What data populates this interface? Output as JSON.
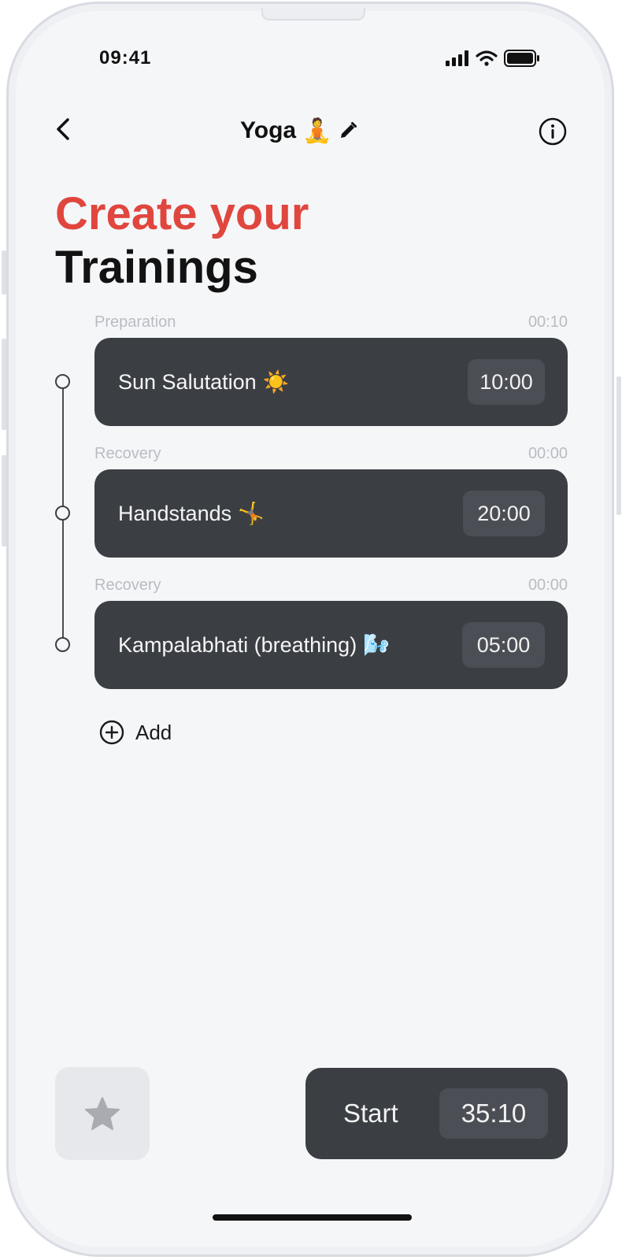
{
  "status_bar": {
    "time": "09:41"
  },
  "header": {
    "title": "Yoga",
    "title_emoji": "🧘"
  },
  "headline": {
    "line1": "Create your",
    "line2": "Trainings"
  },
  "trainings": [
    {
      "section": "Preparation",
      "section_time": "00:10",
      "name": "Sun Salutation",
      "emoji": "☀️",
      "duration": "10:00"
    },
    {
      "section": "Recovery",
      "section_time": "00:00",
      "name": "Handstands",
      "emoji": "🤸",
      "duration": "20:00"
    },
    {
      "section": "Recovery",
      "section_time": "00:00",
      "name": "Kampalabhati (breathing)",
      "emoji": "🌬️",
      "duration": "05:00"
    }
  ],
  "add_button": {
    "label": "Add"
  },
  "bottom": {
    "start_label": "Start",
    "total_time": "35:10"
  },
  "icons": {
    "back": "chevron-left-icon",
    "edit": "pencil-icon",
    "info": "info-circle-icon",
    "add": "plus-circle-icon",
    "favorite": "star-icon",
    "signal": "cellular-signal-icon",
    "wifi": "wifi-icon",
    "battery": "battery-icon"
  },
  "colors": {
    "accent": "#e0463e",
    "card": "#3b3f44",
    "card_chip": "#4b4f55",
    "background": "#f5f6f8"
  }
}
